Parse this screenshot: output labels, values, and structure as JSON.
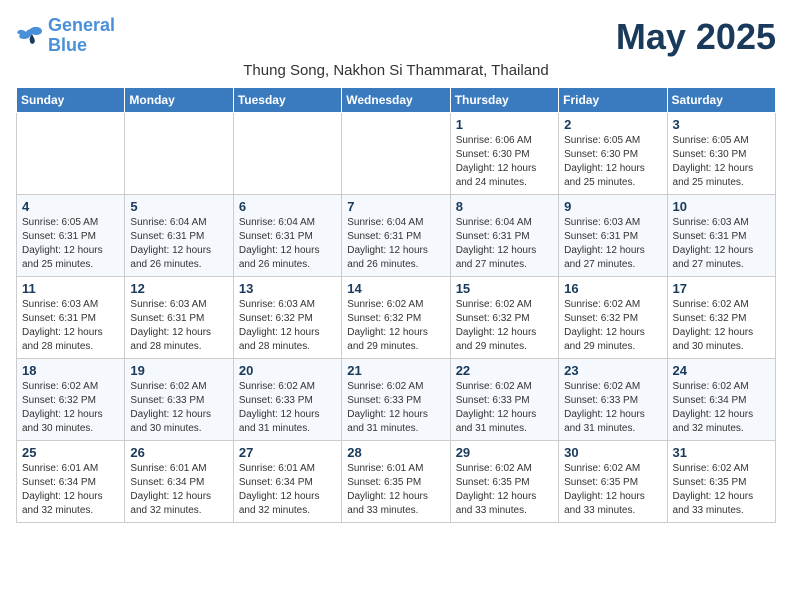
{
  "logo": {
    "line1": "General",
    "line2": "Blue"
  },
  "title": "May 2025",
  "subtitle": "Thung Song, Nakhon Si Thammarat, Thailand",
  "days_header": [
    "Sunday",
    "Monday",
    "Tuesday",
    "Wednesday",
    "Thursday",
    "Friday",
    "Saturday"
  ],
  "weeks": [
    [
      {
        "day": "",
        "info": ""
      },
      {
        "day": "",
        "info": ""
      },
      {
        "day": "",
        "info": ""
      },
      {
        "day": "",
        "info": ""
      },
      {
        "day": "1",
        "info": "Sunrise: 6:06 AM\nSunset: 6:30 PM\nDaylight: 12 hours\nand 24 minutes."
      },
      {
        "day": "2",
        "info": "Sunrise: 6:05 AM\nSunset: 6:30 PM\nDaylight: 12 hours\nand 25 minutes."
      },
      {
        "day": "3",
        "info": "Sunrise: 6:05 AM\nSunset: 6:30 PM\nDaylight: 12 hours\nand 25 minutes."
      }
    ],
    [
      {
        "day": "4",
        "info": "Sunrise: 6:05 AM\nSunset: 6:31 PM\nDaylight: 12 hours\nand 25 minutes."
      },
      {
        "day": "5",
        "info": "Sunrise: 6:04 AM\nSunset: 6:31 PM\nDaylight: 12 hours\nand 26 minutes."
      },
      {
        "day": "6",
        "info": "Sunrise: 6:04 AM\nSunset: 6:31 PM\nDaylight: 12 hours\nand 26 minutes."
      },
      {
        "day": "7",
        "info": "Sunrise: 6:04 AM\nSunset: 6:31 PM\nDaylight: 12 hours\nand 26 minutes."
      },
      {
        "day": "8",
        "info": "Sunrise: 6:04 AM\nSunset: 6:31 PM\nDaylight: 12 hours\nand 27 minutes."
      },
      {
        "day": "9",
        "info": "Sunrise: 6:03 AM\nSunset: 6:31 PM\nDaylight: 12 hours\nand 27 minutes."
      },
      {
        "day": "10",
        "info": "Sunrise: 6:03 AM\nSunset: 6:31 PM\nDaylight: 12 hours\nand 27 minutes."
      }
    ],
    [
      {
        "day": "11",
        "info": "Sunrise: 6:03 AM\nSunset: 6:31 PM\nDaylight: 12 hours\nand 28 minutes."
      },
      {
        "day": "12",
        "info": "Sunrise: 6:03 AM\nSunset: 6:31 PM\nDaylight: 12 hours\nand 28 minutes."
      },
      {
        "day": "13",
        "info": "Sunrise: 6:03 AM\nSunset: 6:32 PM\nDaylight: 12 hours\nand 28 minutes."
      },
      {
        "day": "14",
        "info": "Sunrise: 6:02 AM\nSunset: 6:32 PM\nDaylight: 12 hours\nand 29 minutes."
      },
      {
        "day": "15",
        "info": "Sunrise: 6:02 AM\nSunset: 6:32 PM\nDaylight: 12 hours\nand 29 minutes."
      },
      {
        "day": "16",
        "info": "Sunrise: 6:02 AM\nSunset: 6:32 PM\nDaylight: 12 hours\nand 29 minutes."
      },
      {
        "day": "17",
        "info": "Sunrise: 6:02 AM\nSunset: 6:32 PM\nDaylight: 12 hours\nand 30 minutes."
      }
    ],
    [
      {
        "day": "18",
        "info": "Sunrise: 6:02 AM\nSunset: 6:32 PM\nDaylight: 12 hours\nand 30 minutes."
      },
      {
        "day": "19",
        "info": "Sunrise: 6:02 AM\nSunset: 6:33 PM\nDaylight: 12 hours\nand 30 minutes."
      },
      {
        "day": "20",
        "info": "Sunrise: 6:02 AM\nSunset: 6:33 PM\nDaylight: 12 hours\nand 31 minutes."
      },
      {
        "day": "21",
        "info": "Sunrise: 6:02 AM\nSunset: 6:33 PM\nDaylight: 12 hours\nand 31 minutes."
      },
      {
        "day": "22",
        "info": "Sunrise: 6:02 AM\nSunset: 6:33 PM\nDaylight: 12 hours\nand 31 minutes."
      },
      {
        "day": "23",
        "info": "Sunrise: 6:02 AM\nSunset: 6:33 PM\nDaylight: 12 hours\nand 31 minutes."
      },
      {
        "day": "24",
        "info": "Sunrise: 6:02 AM\nSunset: 6:34 PM\nDaylight: 12 hours\nand 32 minutes."
      }
    ],
    [
      {
        "day": "25",
        "info": "Sunrise: 6:01 AM\nSunset: 6:34 PM\nDaylight: 12 hours\nand 32 minutes."
      },
      {
        "day": "26",
        "info": "Sunrise: 6:01 AM\nSunset: 6:34 PM\nDaylight: 12 hours\nand 32 minutes."
      },
      {
        "day": "27",
        "info": "Sunrise: 6:01 AM\nSunset: 6:34 PM\nDaylight: 12 hours\nand 32 minutes."
      },
      {
        "day": "28",
        "info": "Sunrise: 6:01 AM\nSunset: 6:35 PM\nDaylight: 12 hours\nand 33 minutes."
      },
      {
        "day": "29",
        "info": "Sunrise: 6:02 AM\nSunset: 6:35 PM\nDaylight: 12 hours\nand 33 minutes."
      },
      {
        "day": "30",
        "info": "Sunrise: 6:02 AM\nSunset: 6:35 PM\nDaylight: 12 hours\nand 33 minutes."
      },
      {
        "day": "31",
        "info": "Sunrise: 6:02 AM\nSunset: 6:35 PM\nDaylight: 12 hours\nand 33 minutes."
      }
    ]
  ]
}
